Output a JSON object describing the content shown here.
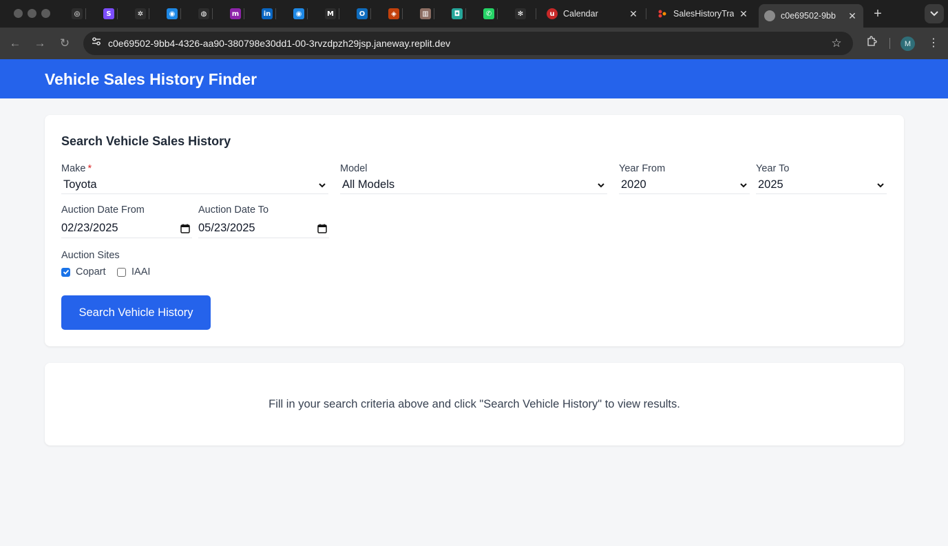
{
  "browser": {
    "pinned_tabs": [
      {
        "icon": "chatgpt-like-icon",
        "color": "#2d2d2d",
        "glyph": "◎"
      },
      {
        "icon": "s-app-icon",
        "color": "#7c4dff",
        "glyph": "S"
      },
      {
        "icon": "gear-bug-icon",
        "color": "#2d2d2d",
        "glyph": "✲"
      },
      {
        "icon": "blue-swirl-icon",
        "color": "#1e88e5",
        "glyph": "◉"
      },
      {
        "icon": "globe-icon",
        "color": "#2d2d2d",
        "glyph": "◍"
      },
      {
        "icon": "m-logo-icon",
        "color": "#8e24aa",
        "glyph": "m"
      },
      {
        "icon": "linkedin-icon",
        "color": "#0a66c2",
        "glyph": "in"
      },
      {
        "icon": "blue-swirl-icon",
        "color": "#1e88e5",
        "glyph": "◉"
      },
      {
        "icon": "gmail-icon",
        "color": "#2d2d2d",
        "glyph": "M"
      },
      {
        "icon": "outlook-icon",
        "color": "#0f6cbd",
        "glyph": "O"
      },
      {
        "icon": "car-icon",
        "color": "#c2410c",
        "glyph": "◈"
      },
      {
        "icon": "bank-icon",
        "color": "#8d6e63",
        "glyph": "▥"
      },
      {
        "icon": "robot-icon",
        "color": "#26a69a",
        "glyph": "◘"
      },
      {
        "icon": "whatsapp-icon",
        "color": "#25d366",
        "glyph": "✆"
      },
      {
        "icon": "openai-icon",
        "color": "#2d2d2d",
        "glyph": "✻"
      }
    ],
    "tabs": [
      {
        "title": "Calendar",
        "icon": "ut-icon",
        "color": "#c62828"
      },
      {
        "title": "SalesHistoryTra",
        "icon": "dots-icon",
        "color": "#e53935"
      },
      {
        "title": "c0e69502-9bb",
        "icon": "globe-icon",
        "color": "#9e9e9e",
        "active": true
      }
    ],
    "new_tab": "+",
    "tab_menu": "⌄",
    "url": "c0e69502-9bb4-4326-aa90-380798e30dd1-00-3rvzdpzh29jsp.janeway.replit.dev",
    "profile_initial": "M"
  },
  "app": {
    "title": "Vehicle Sales History Finder",
    "accent": "#2563eb",
    "search": {
      "heading": "Search Vehicle Sales History",
      "make": {
        "label": "Make",
        "required": "*",
        "value": "Toyota"
      },
      "model": {
        "label": "Model",
        "value": "All Models"
      },
      "year_from": {
        "label": "Year From",
        "value": "2020"
      },
      "year_to": {
        "label": "Year To",
        "value": "2025"
      },
      "date_from": {
        "label": "Auction Date From",
        "value": "02/23/2025"
      },
      "date_to": {
        "label": "Auction Date To",
        "value": "05/23/2025"
      },
      "sites": {
        "label": "Auction Sites",
        "options": [
          {
            "label": "Copart",
            "checked": true
          },
          {
            "label": "IAAI",
            "checked": false
          }
        ]
      },
      "button": "Search Vehicle History"
    },
    "results": {
      "empty_message": "Fill in your search criteria above and click \"Search Vehicle History\" to view results."
    }
  }
}
